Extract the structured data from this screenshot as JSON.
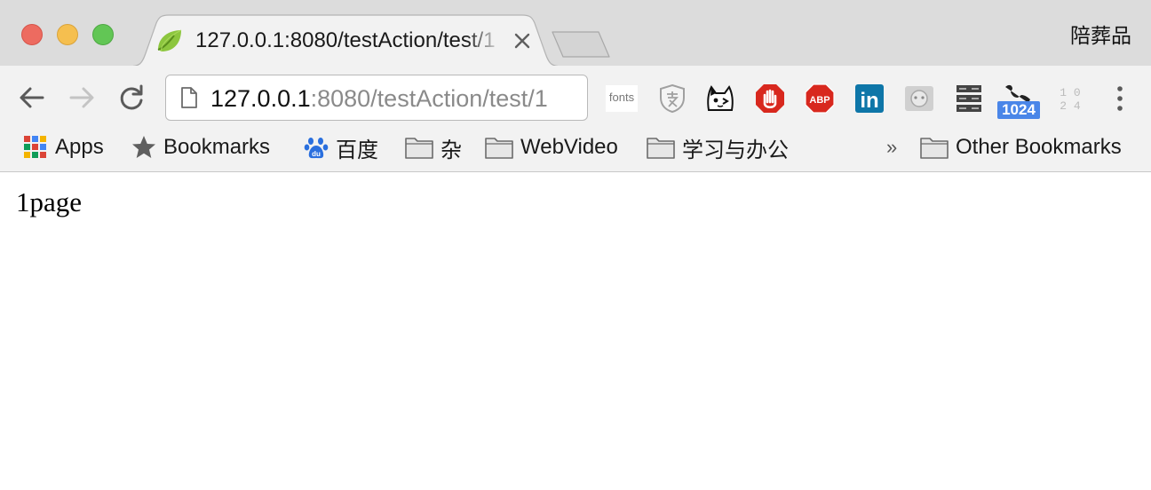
{
  "window": {
    "profile_name": "陪葬品"
  },
  "tab": {
    "title": "127.0.0.1:8080/testAction/test/1"
  },
  "omnibox": {
    "host": "127.0.0.1",
    "path": ":8080/testAction/test/1"
  },
  "extensions": [
    {
      "name": "fonts-extension",
      "label": "fonts"
    },
    {
      "name": "zhi-extension-icon"
    },
    {
      "name": "cat-extension-icon"
    },
    {
      "name": "stop-hand-extension-icon"
    },
    {
      "name": "adblock-plus-icon",
      "label": "ABP"
    },
    {
      "name": "linkedin-icon",
      "label": "in"
    },
    {
      "name": "anime-extension-icon"
    },
    {
      "name": "server-extension-icon"
    },
    {
      "name": "phone-extension-icon",
      "badge": "1024"
    },
    {
      "name": "numbers-extension-icon",
      "label": "10 24"
    }
  ],
  "bookmarks": {
    "apps": "Apps",
    "bookmarks": "Bookmarks",
    "baidu": "百度",
    "misc": "杂",
    "webvideo": "WebVideo",
    "study": "学习与办公",
    "overflow": "»",
    "other": "Other Bookmarks"
  },
  "page": {
    "text": "1page"
  },
  "colors": {
    "tabstrip": "#dcdcdc",
    "toolbar": "#f2f2f2",
    "badge": "#4a86e8",
    "abp_red": "#d8281e",
    "linkedin": "#0e76a8"
  }
}
